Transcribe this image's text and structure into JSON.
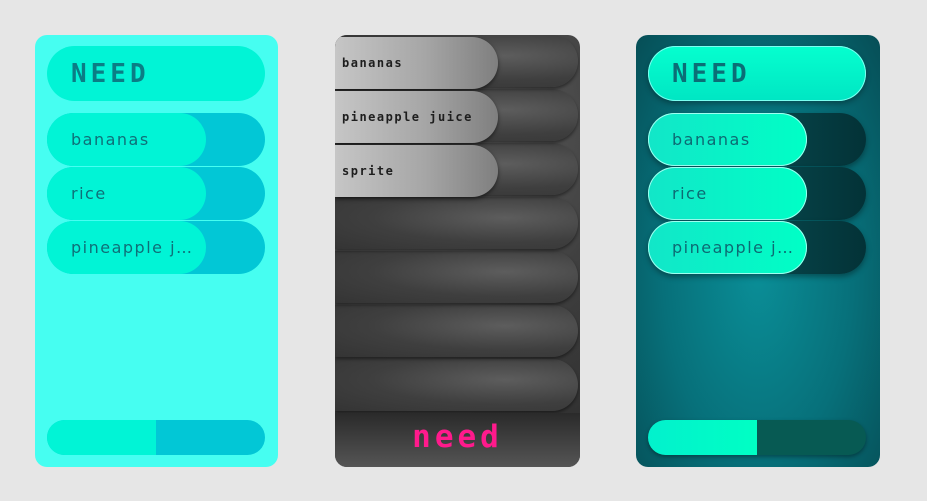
{
  "card1": {
    "title": "NEED",
    "items": [
      {
        "label": "bananas"
      },
      {
        "label": "rice"
      },
      {
        "label": "pineapple juice"
      }
    ],
    "progress": 0.5
  },
  "card2": {
    "items": [
      {
        "label": "bananas"
      },
      {
        "label": "pineapple juice"
      },
      {
        "label": "sprite"
      }
    ],
    "empty_slots": 4,
    "footer": "need"
  },
  "card3": {
    "title": "NEED",
    "items": [
      {
        "label": "bananas"
      },
      {
        "label": "rice"
      },
      {
        "label": "pineapple juice"
      }
    ],
    "progress": 0.5
  },
  "colors": {
    "cyan_bg": "#46fef1",
    "cyan_fill": "#01f4d6",
    "cyan_track": "#02c7d6",
    "pink_accent": "#ff1a8c",
    "teal_bg": "#07707a"
  }
}
